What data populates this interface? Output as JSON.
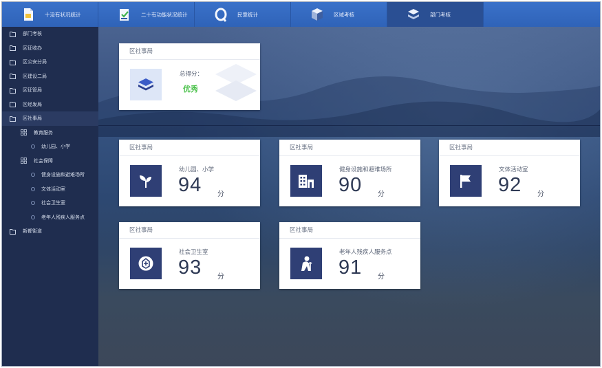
{
  "nav": {
    "tabs": [
      {
        "label": "十没有状况统计",
        "icon": "document-flag-icon",
        "active": false
      },
      {
        "label": "二十有功能状况统计",
        "icon": "checklist-shield-icon",
        "active": false
      },
      {
        "label": "民意统计",
        "icon": "magnifier-icon",
        "active": false
      },
      {
        "label": "区域考核",
        "icon": "cube-icon",
        "active": false
      },
      {
        "label": "部门考核",
        "icon": "layers-icon",
        "active": true
      }
    ]
  },
  "sidebar": {
    "items": [
      {
        "label": "部门考核",
        "level": 0,
        "icon": "folder-icon"
      },
      {
        "label": "区征收办",
        "level": 0,
        "icon": "folder-icon"
      },
      {
        "label": "区公安分局",
        "level": 0,
        "icon": "folder-icon"
      },
      {
        "label": "区建设二局",
        "level": 0,
        "icon": "folder-icon"
      },
      {
        "label": "区征管局",
        "level": 0,
        "icon": "folder-icon"
      },
      {
        "label": "区经发局",
        "level": 0,
        "icon": "folder-icon"
      },
      {
        "label": "区社事局",
        "level": 0,
        "icon": "folder-icon",
        "active": true
      },
      {
        "label": "教育服务",
        "level": 1,
        "icon": "grid-icon"
      },
      {
        "label": "幼儿园、小学",
        "level": 2,
        "icon": "circle-icon"
      },
      {
        "label": "社会保障",
        "level": 1,
        "icon": "grid-icon"
      },
      {
        "label": "健身设施和避难场所",
        "level": 2,
        "icon": "circle-icon"
      },
      {
        "label": "文体活动室",
        "level": 2,
        "icon": "circle-icon"
      },
      {
        "label": "社会卫生室",
        "level": 2,
        "icon": "circle-icon"
      },
      {
        "label": "老年人残疾人服务点",
        "level": 2,
        "icon": "circle-icon"
      },
      {
        "label": "新都街道",
        "level": 0,
        "icon": "folder-icon"
      }
    ]
  },
  "summary": {
    "title": "区社事局",
    "total_label": "总得分：",
    "grade": "优秀",
    "icon": "layers-icon"
  },
  "cards": [
    {
      "title": "区社事局",
      "name": "幼儿园、小学",
      "score": "94",
      "unit": "分",
      "icon": "sprout-icon"
    },
    {
      "title": "区社事局",
      "name": "健身设施和避难场所",
      "score": "90",
      "unit": "分",
      "icon": "building-icon"
    },
    {
      "title": "区社事局",
      "name": "文体活动室",
      "score": "92",
      "unit": "分",
      "icon": "flag-icon"
    },
    {
      "title": "区社事局",
      "name": "社会卫生室",
      "score": "93",
      "unit": "分",
      "icon": "clinic-icon"
    },
    {
      "title": "区社事局",
      "name": "老年人残疾人服务点",
      "score": "91",
      "unit": "分",
      "icon": "elderly-icon"
    }
  ],
  "colors": {
    "nav_bg": "#3368bf",
    "sidebar_bg": "#1f2d4f",
    "icon_box": "#2f3f75",
    "grade_green": "#4cc24c"
  }
}
